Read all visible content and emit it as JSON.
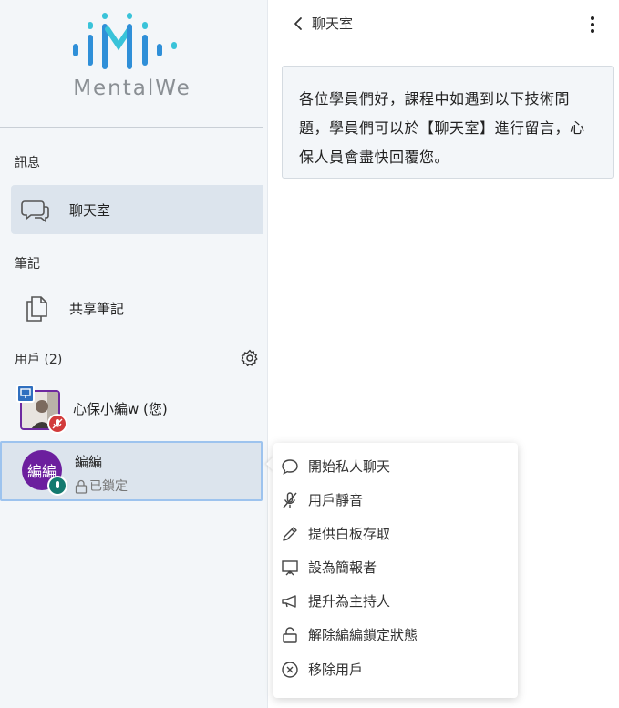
{
  "logo": {
    "text": "MentalWe",
    "color_primary": "#2f8fd8",
    "color_accent": "#39c3d9"
  },
  "sidebar": {
    "messages_section": "訊息",
    "chat_item": "聊天室",
    "notes_section": "筆記",
    "shared_notes_item": "共享筆記",
    "users_section": "用戶 (2)",
    "users": [
      {
        "name": "心保小編w (您)",
        "status": "",
        "role": "presenter",
        "mic": "muted"
      },
      {
        "name": "編編",
        "avatar_initials": "編編",
        "status": "已鎖定",
        "mic": "on",
        "avatar_color": "#6c1f9e"
      }
    ]
  },
  "main": {
    "chat_title": "聊天室",
    "welcome_message": "各位學員們好，課程中如遇到以下技術問題，學員們可以於【聊天室】進行留言，心保人員會盡快回覆您。"
  },
  "context_menu": {
    "items": [
      {
        "label": "開始私人聊天",
        "icon": "chat-bubble-icon"
      },
      {
        "label": "用戶靜音",
        "icon": "mic-off-icon"
      },
      {
        "label": "提供白板存取",
        "icon": "pencil-icon"
      },
      {
        "label": "設為簡報者",
        "icon": "presentation-icon"
      },
      {
        "label": "提升為主持人",
        "icon": "megaphone-icon"
      },
      {
        "label": "解除編編鎖定狀態",
        "icon": "unlock-icon"
      },
      {
        "label": "移除用戶",
        "icon": "remove-circle-icon"
      }
    ]
  }
}
